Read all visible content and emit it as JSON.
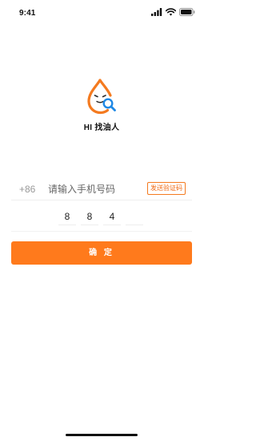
{
  "status_bar": {
    "time": "9:41",
    "icons": [
      "signal-icon",
      "wifi-icon",
      "battery-icon"
    ]
  },
  "app": {
    "name": "HI 找油人",
    "logo_icon": "oil-drop-search-icon",
    "brand_color": "#F47A1F",
    "accent_color": "#1E88E5"
  },
  "login": {
    "country_code": "+86",
    "phone_placeholder": "请输入手机号码",
    "phone_value": "",
    "send_code_label": "发送验证码",
    "code_digits": [
      "8",
      "8",
      "4",
      ""
    ],
    "confirm_label": "确 定"
  }
}
